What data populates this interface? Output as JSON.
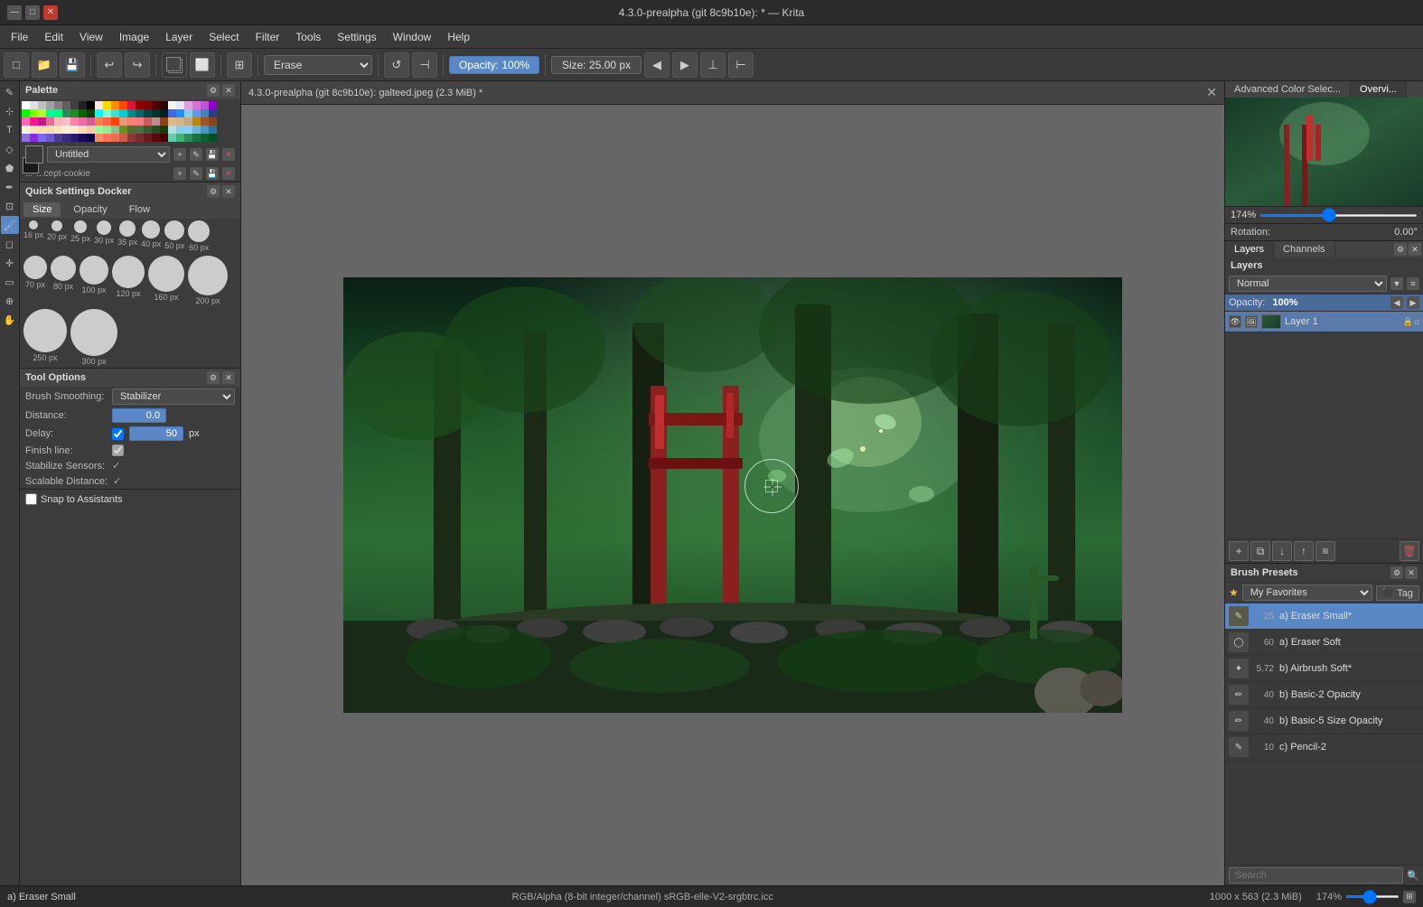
{
  "titlebar": {
    "title": "4.3.0-prealpha (git 8c9b10e): * — Krita"
  },
  "menubar": {
    "items": [
      "File",
      "Edit",
      "View",
      "Image",
      "Layer",
      "Select",
      "Filter",
      "Tools",
      "Settings",
      "Window",
      "Help"
    ]
  },
  "toolbar": {
    "brush_name": "Erase",
    "opacity_label": "Opacity: 100%",
    "size_label": "Size: 25.00 px"
  },
  "canvas_tab": {
    "title": "4.3.0-prealpha (git 8c9b10e): galteed.jpeg (2.3 MiB) *"
  },
  "palette": {
    "title": "Palette",
    "palette_name": "Untitled",
    "cookie_label": "...cept-cookie"
  },
  "quick_settings": {
    "title": "Quick Settings Docker",
    "tabs": [
      "Size",
      "Opacity",
      "Flow"
    ],
    "brush_sizes": [
      {
        "size": 16,
        "label": "16 px"
      },
      {
        "size": 20,
        "label": "20 px"
      },
      {
        "size": 25,
        "label": "25 px"
      },
      {
        "size": 30,
        "label": "30 px"
      },
      {
        "size": 35,
        "label": "35 px"
      },
      {
        "size": 40,
        "label": "40 px"
      },
      {
        "size": 50,
        "label": "50 px"
      },
      {
        "size": 60,
        "label": "60 px"
      },
      {
        "size": 70,
        "label": "70 px"
      },
      {
        "size": 80,
        "label": "80 px"
      },
      {
        "size": 100,
        "label": "100 px"
      },
      {
        "size": 120,
        "label": "120 px"
      },
      {
        "size": 160,
        "label": "160 px"
      },
      {
        "size": 200,
        "label": "200 px"
      },
      {
        "size": 250,
        "label": "250 px"
      },
      {
        "size": 300,
        "label": "300 px"
      }
    ]
  },
  "tool_options": {
    "title": "Tool Options",
    "smoothing_label": "Brush Smoothing:",
    "smoothing_value": "Stabilizer",
    "distance_label": "Distance:",
    "distance_value": "0.0",
    "delay_label": "Delay:",
    "delay_value": "50",
    "delay_unit": "px",
    "finish_line_label": "Finish line:",
    "stabilize_label": "Stabilize Sensors:",
    "scalable_label": "Scalable Distance:"
  },
  "snap": {
    "label": "Snap to Assistants"
  },
  "overview": {
    "tabs": [
      "Advanced Color Selec...",
      "Overvi..."
    ],
    "active_tab": "Overvi...",
    "zoom_percent": "174%",
    "rotation_label": "Rotation:",
    "rotation_value": "0.00°"
  },
  "layers": {
    "title": "Layers",
    "tabs": [
      "Layers",
      "Channels"
    ],
    "blend_mode": "Normal",
    "opacity_label": "Opacity:",
    "opacity_value": "100%",
    "items": [
      {
        "name": "Layer 1",
        "visible": true
      }
    ],
    "toolbar_btns": [
      "+",
      "⧉",
      "↓",
      "↑",
      "≡",
      "🗑"
    ]
  },
  "brush_presets": {
    "title": "Brush Presets",
    "filter_label": "My Favorites",
    "tag_label": "Tag",
    "items": [
      {
        "number": "25",
        "name": "a) Eraser Small*",
        "active": true
      },
      {
        "number": "60",
        "name": "a) Eraser Soft",
        "active": false
      },
      {
        "number": "5.72",
        "name": "b) Airbrush Soft*",
        "active": false
      },
      {
        "number": "40",
        "name": "b) Basic-2 Opacity",
        "active": false
      },
      {
        "number": "40",
        "name": "b) Basic-5 Size Opacity",
        "active": false
      },
      {
        "number": "10",
        "name": "c) Pencil-2",
        "active": false
      }
    ],
    "search_placeholder": "Search"
  },
  "statusbar": {
    "brush_name": "a) Eraser Small",
    "color_info": "RGB/Alpha (8-bit integer/channel)  sRGB-elle-V2-srgbtrc.icc",
    "dimensions": "1000 x 563 (2.3 MiB)",
    "zoom_percent": "174%"
  },
  "colors": {
    "accent_blue": "#5a87c5",
    "active_layer": "#5a7aaa",
    "active_brush": "#5a87c5"
  }
}
